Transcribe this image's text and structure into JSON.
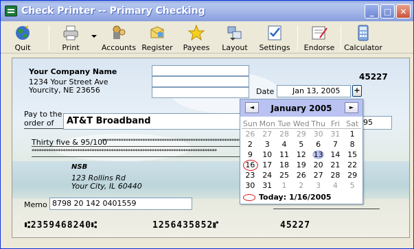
{
  "window": {
    "title": "Check Printer -- Primary Checking"
  },
  "toolbar": {
    "items": [
      {
        "label": "Quit",
        "icon": "globe-icon"
      },
      {
        "label": "Print",
        "icon": "printer-icon"
      },
      {
        "label": "Accounts",
        "icon": "accounts-icon"
      },
      {
        "label": "Register",
        "icon": "register-icon"
      },
      {
        "label": "Payees",
        "icon": "star-icon"
      },
      {
        "label": "Layout",
        "icon": "layout-icon"
      },
      {
        "label": "Settings",
        "icon": "settings-icon"
      },
      {
        "label": "Endorse",
        "icon": "endorse-icon"
      },
      {
        "label": "Calculator",
        "icon": "calculator-icon"
      }
    ]
  },
  "check": {
    "company_name": "Your Company Name",
    "company_address1": "1234 Your Street Ave",
    "company_address2": "Yourcity, NE 23656",
    "check_number": "45227",
    "date_label": "Date",
    "date_value": "Jan 13, 2005",
    "date_button": "+",
    "pay_to_line1": "Pay to the",
    "pay_to_line2": "order of",
    "payee": "AT&T Broadband",
    "amount": "95",
    "amount_words": "Thirty five & 95/100",
    "bank_name": "NSB",
    "bank_address1": "123 Rollins Rd",
    "bank_address2": "Your City, IL 60440",
    "memo_label": "Memo",
    "memo_value": "8798 20 142 0401559",
    "micr_routing": "⑆2359468240⑆",
    "micr_account": "1256435852⑈",
    "micr_check": "45227"
  },
  "calendar": {
    "month_label": "January 2005",
    "prev_label": "◄",
    "next_label": "►",
    "weekdays": [
      "Sun",
      "Mon",
      "Tue",
      "Wed",
      "Thu",
      "Fri",
      "Sat"
    ],
    "weeks": [
      [
        "26",
        "27",
        "28",
        "29",
        "30",
        "31",
        "1"
      ],
      [
        "2",
        "3",
        "4",
        "5",
        "6",
        "7",
        "8"
      ],
      [
        "9",
        "10",
        "11",
        "12",
        "13",
        "14",
        "15"
      ],
      [
        "16",
        "17",
        "18",
        "19",
        "20",
        "21",
        "22"
      ],
      [
        "23",
        "24",
        "25",
        "26",
        "27",
        "28",
        "29"
      ],
      [
        "30",
        "31",
        "1",
        "2",
        "3",
        "4",
        "5"
      ]
    ],
    "selected_day": "13",
    "today_day": "16",
    "today_text": "Today: 1/16/2005"
  },
  "colors": {
    "title_gradient": "#a7b9ea",
    "calendar_header": "#b9c2f0",
    "today_ring": "#dd1111"
  }
}
